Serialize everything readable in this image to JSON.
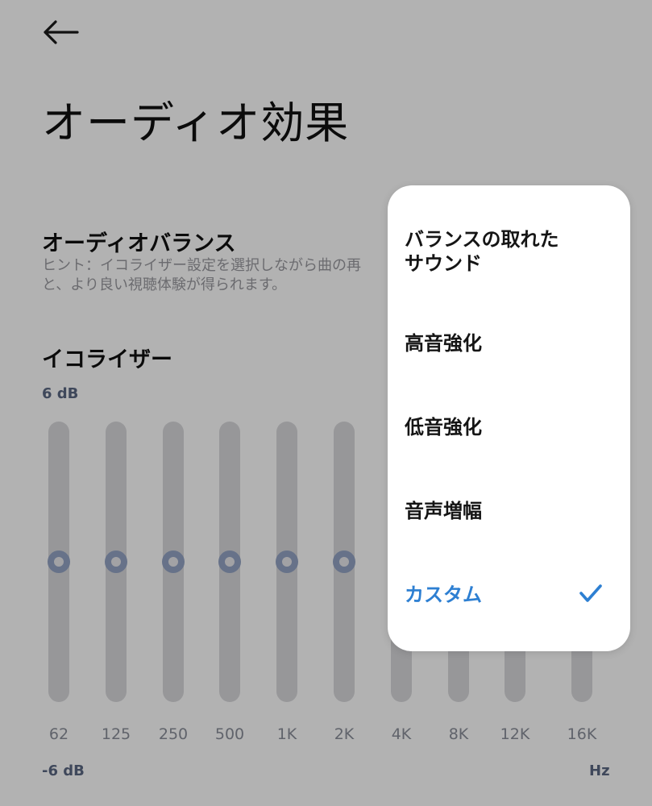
{
  "header": {
    "back_icon": "arrow-left-icon",
    "title": "オーディオ効果"
  },
  "balance_section": {
    "title": "オーディオバランス",
    "hint_line1": "ヒント：イコライザー設定を選択しながら曲の再",
    "hint_line2": "と、より良い視聴体験が得られます。"
  },
  "equalizer": {
    "title": "イコライザー",
    "max_label": "6 dB",
    "min_label": "-6 dB",
    "unit_label": "Hz",
    "bands": [
      {
        "label": "62",
        "gain_db": 0
      },
      {
        "label": "125",
        "gain_db": 0
      },
      {
        "label": "250",
        "gain_db": 0
      },
      {
        "label": "500",
        "gain_db": 0
      },
      {
        "label": "1K",
        "gain_db": 0
      },
      {
        "label": "2K",
        "gain_db": 0
      },
      {
        "label": "4K"
      },
      {
        "label": "8K"
      },
      {
        "label": "12K"
      },
      {
        "label": "16K"
      }
    ]
  },
  "dropdown": {
    "items": [
      {
        "label": "バランスの取れたサウンド",
        "line1": "バランスの取れた",
        "line2": "サウンド"
      },
      {
        "label": "高音強化"
      },
      {
        "label": "低音強化"
      },
      {
        "label": "音声増幅"
      },
      {
        "label": "カスタム",
        "selected": true
      }
    ],
    "check_icon": "checkmark-icon",
    "accent_color": "#2d7fd2"
  }
}
